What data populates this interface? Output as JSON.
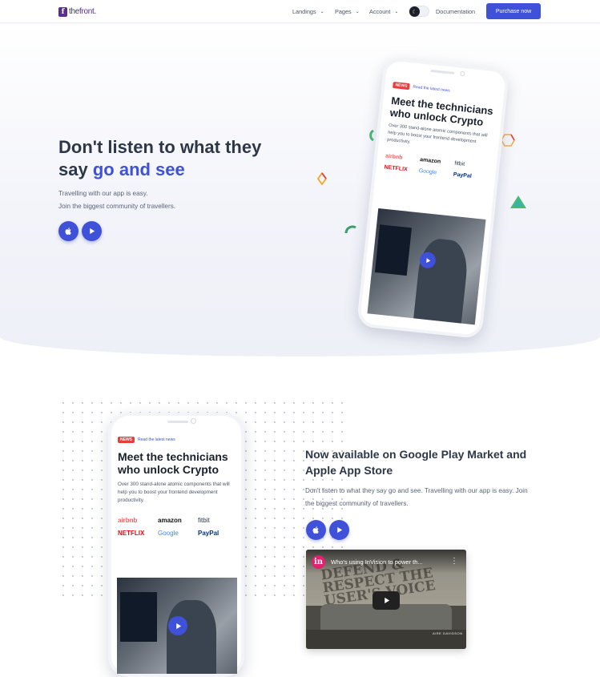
{
  "nav": {
    "logo_prefix": "the",
    "logo_suffix": "front.",
    "logo_mark": "f",
    "items": [
      {
        "label": "Landings",
        "icon": "chevron-down-icon"
      },
      {
        "label": "Pages",
        "icon": "chevron-down-icon"
      },
      {
        "label": "Account",
        "icon": "chevron-down-icon"
      }
    ],
    "theme_toggle_icon": "moon-icon",
    "documentation": "Documentation",
    "purchase": "Purchase now"
  },
  "hero": {
    "title_part1": "Don't listen to what they say",
    "title_accent": "go and see",
    "subtitle_line1": "Travelling with our app is easy.",
    "subtitle_line2": "Join the biggest community of travellers.",
    "buttons": [
      {
        "icon": "apple-icon"
      },
      {
        "icon": "play-icon"
      }
    ]
  },
  "phone_mock": {
    "badge": "NEWS",
    "link": "Read the latest news",
    "title": "Meet the technicians who unlock Crypto",
    "text": "Over 300 stand-alone atomic components that will help you to boost your frontend development productivity.",
    "brands": [
      "airbnb",
      "amazon",
      "fitbit",
      "NETFLIX",
      "Google",
      "PayPal"
    ]
  },
  "section2": {
    "title": "Now available on Google Play Market and Apple App Store",
    "text": "Don't listen to what they say go and see. Travelling with our app is easy. Join the biggest community of travellers.",
    "buttons": [
      {
        "icon": "apple-icon"
      },
      {
        "icon": "play-icon"
      }
    ]
  },
  "video": {
    "channel_initial": "in",
    "title": "Who's using InVision to power th...",
    "caption": "AIRE DAVIDSON",
    "wall_text": "DEFEND & RESPECT THE USER'S VOICE"
  },
  "colors": {
    "primary": "#3f51d8",
    "heading": "#2d3748",
    "news": "#e53e3e"
  }
}
